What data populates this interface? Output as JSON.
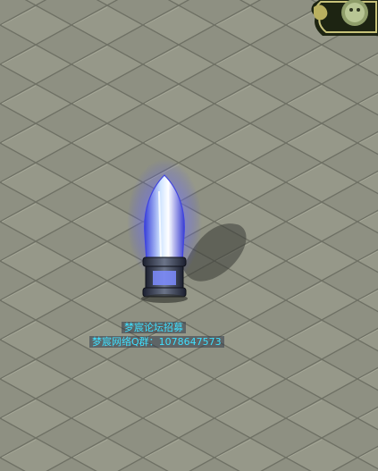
{
  "npc": {
    "name_line1": "梦宸论坛招募",
    "name_line2": "梦宸网络Q群：1078647573"
  },
  "icons": {
    "corner_emblem": "ornate-portrait-frame-icon",
    "crystal": "blue-crystal-pillar-icon"
  },
  "colors": {
    "floor": "#8f9183",
    "npc_name": "#3fe0ff",
    "crystal_glow": "#6f7bff"
  }
}
